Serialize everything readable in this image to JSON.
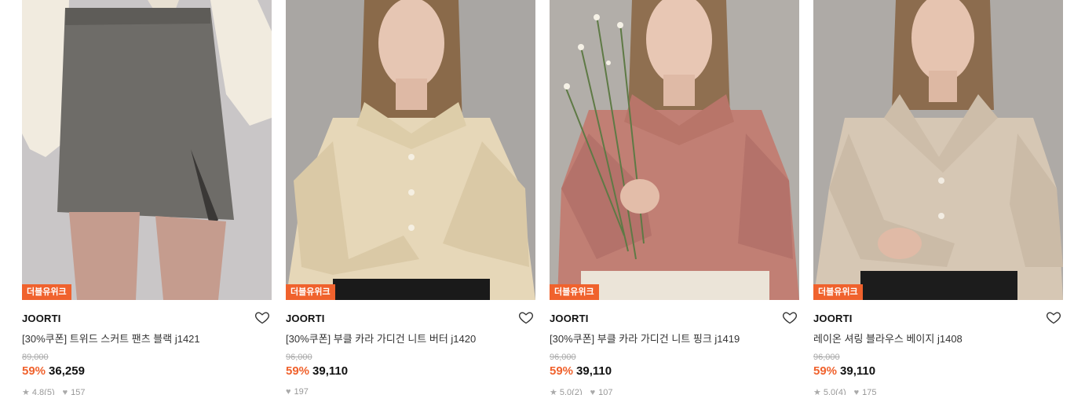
{
  "products": [
    {
      "badge": "더블유위크",
      "brand": "JOORTI",
      "title": "[30%쿠폰] 트위드 스커트 팬츠 블랙 j1421",
      "original_price": "89,000",
      "discount": "59%",
      "price": "36,259",
      "rating": "4.8",
      "reviews": "(5)",
      "likes": "157",
      "colors": {
        "bg": "#c9c6c7",
        "garment": "#6e6c68",
        "top": "#f1ebdf"
      }
    },
    {
      "badge": "더블유위크",
      "brand": "JOORTI",
      "title": "[30%쿠폰] 부클 카라 가디건 니트 버터 j1420",
      "original_price": "96,000",
      "discount": "59%",
      "price": "39,110",
      "rating": "",
      "reviews": "",
      "likes": "197",
      "colors": {
        "bg": "#a9a6a3",
        "garment": "#e6d7b8",
        "top": "#e6d7b8"
      }
    },
    {
      "badge": "더블유위크",
      "brand": "JOORTI",
      "title": "[30%쿠폰] 부클 카라 가디건 니트 핑크 j1419",
      "original_price": "96,000",
      "discount": "59%",
      "price": "39,110",
      "rating": "5.0",
      "reviews": "(2)",
      "likes": "107",
      "colors": {
        "bg": "#b2aea9",
        "garment": "#c17f74",
        "top": "#c17f74"
      }
    },
    {
      "badge": "더블유위크",
      "brand": "JOORTI",
      "title": "레이온 셔링 블라우스 베이지 j1408",
      "original_price": "96,000",
      "discount": "59%",
      "price": "39,110",
      "rating": "5.0",
      "reviews": "(4)",
      "likes": "175",
      "colors": {
        "bg": "#aeaaa6",
        "garment": "#d6c7b4",
        "top": "#d6c7b4"
      }
    }
  ],
  "icons": {
    "heart": "heart-outline-icon",
    "star": "star-icon",
    "likes": "heart-filled-icon"
  }
}
